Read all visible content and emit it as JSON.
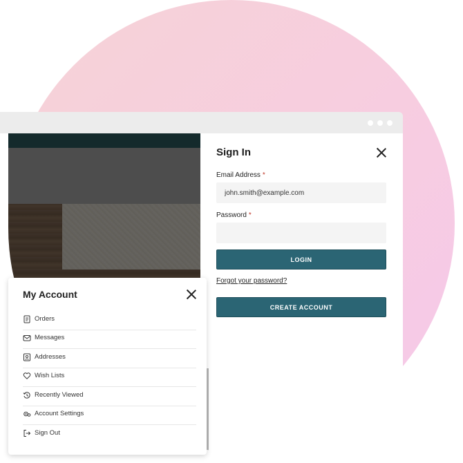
{
  "signin": {
    "title": "Sign In",
    "email_label": "Email Address",
    "required_mark": "*",
    "email_value": "john.smith@example.com",
    "password_label": "Password",
    "password_value": "",
    "login_label": "LOGIN",
    "forgot_label": "Forgot your password?",
    "create_label": "CREATE ACCOUNT"
  },
  "account": {
    "title": "My Account",
    "items": [
      {
        "label": "Orders",
        "icon": "receipt-icon"
      },
      {
        "label": "Messages",
        "icon": "envelope-icon"
      },
      {
        "label": "Addresses",
        "icon": "address-book-icon"
      },
      {
        "label": "Wish Lists",
        "icon": "heart-icon"
      },
      {
        "label": "Recently Viewed",
        "icon": "history-icon"
      },
      {
        "label": "Account Settings",
        "icon": "settings-icon"
      },
      {
        "label": "Sign Out",
        "icon": "sign-out-icon"
      }
    ]
  },
  "colors": {
    "primary_button": "#2b6574",
    "required": "#c0392b",
    "site_header": "#1d3b3d",
    "background_gradient_start": "#f6d3d6",
    "background_gradient_end": "#f6c8ea"
  }
}
